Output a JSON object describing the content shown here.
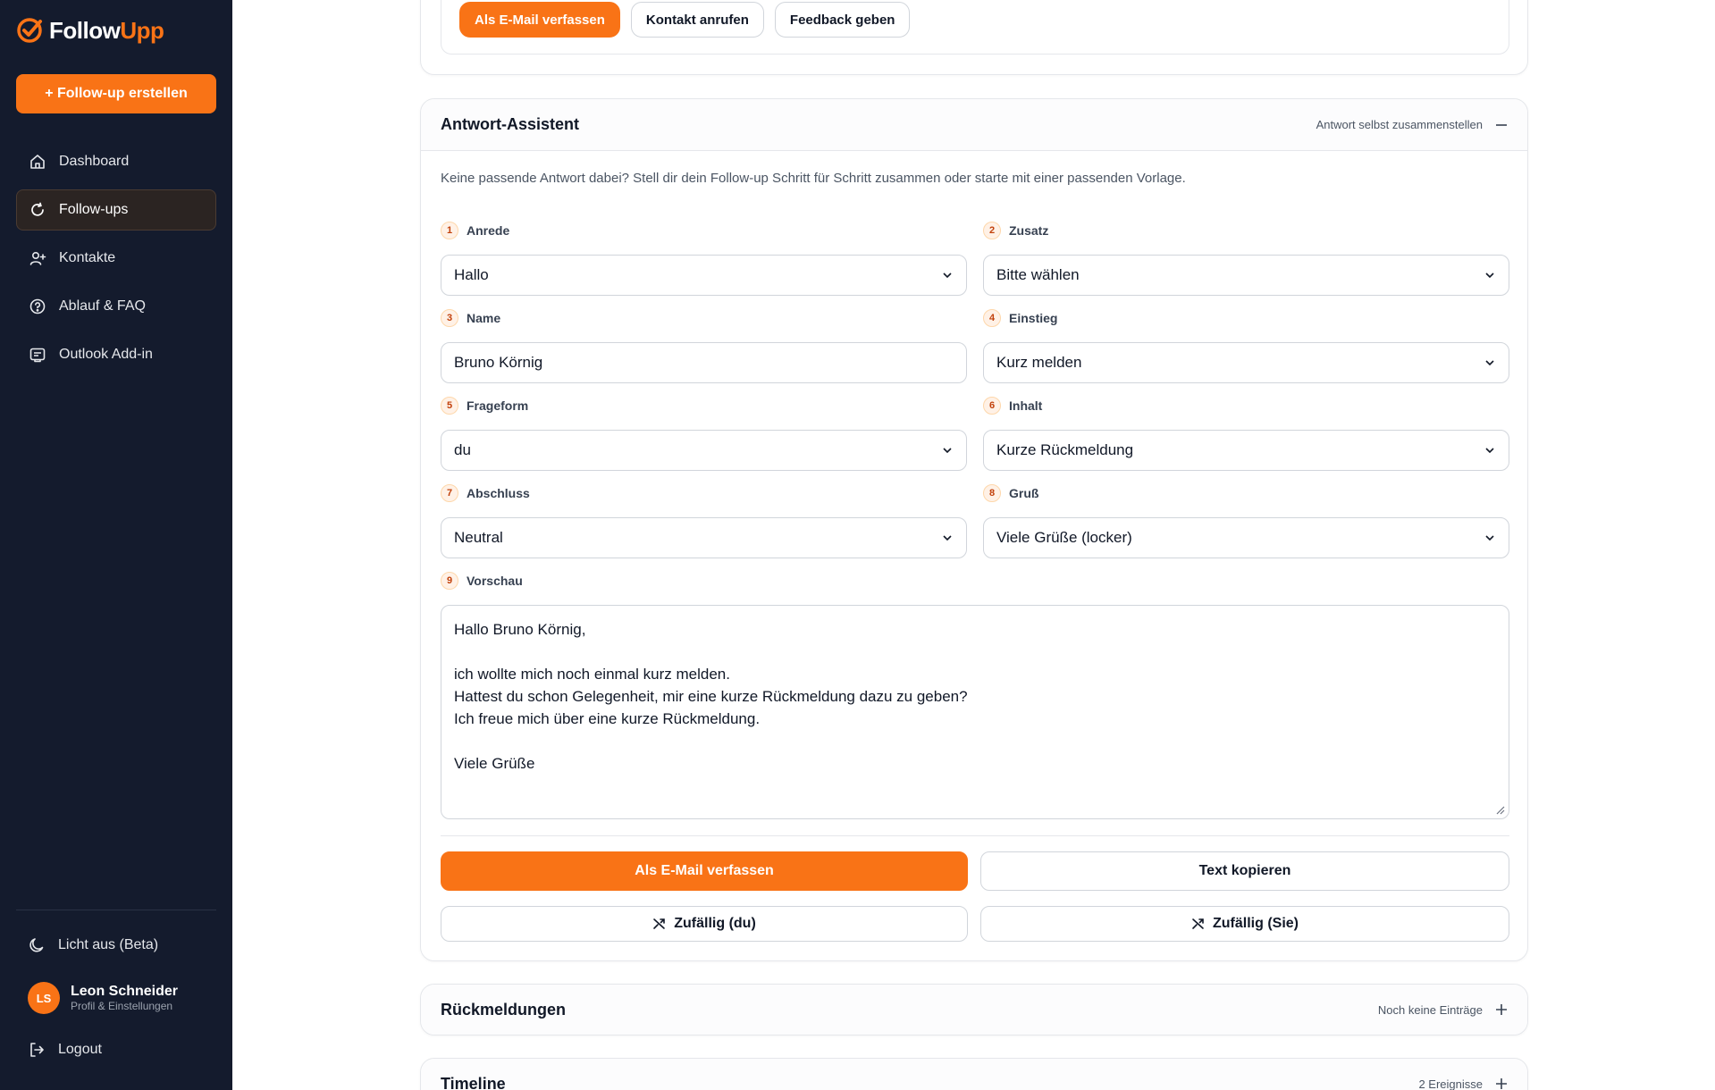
{
  "brand": {
    "name_a": "Follow",
    "name_b": "Upp",
    "accent": "#f97316",
    "sidebar_bg": "#141b2d"
  },
  "sidebar": {
    "create_label": "+ Follow-up erstellen",
    "items": [
      {
        "label": "Dashboard",
        "icon": "home-icon"
      },
      {
        "label": "Follow-ups",
        "icon": "refresh-icon",
        "active": true
      },
      {
        "label": "Kontakte",
        "icon": "user-plus-icon"
      },
      {
        "label": "Ablauf & FAQ",
        "icon": "help-circle-icon"
      },
      {
        "label": "Outlook Add-in",
        "icon": "mail-box-icon"
      }
    ],
    "theme_toggle": "Licht aus (Beta)",
    "user": {
      "initials": "LS",
      "name": "Leon Schneider",
      "sub": "Profil & Einstellungen"
    },
    "logout": "Logout"
  },
  "top_actions": {
    "email": "Als E-Mail verfassen",
    "call": "Kontakt anrufen",
    "feedback": "Feedback geben"
  },
  "assistant": {
    "title": "Antwort-Assistent",
    "head_action": "Antwort selbst zusammenstellen",
    "intro": "Keine passende Antwort dabei? Stell dir dein Follow-up Schritt für Schritt zusammen oder starte mit einer passenden Vorlage.",
    "fields": [
      {
        "num": "1",
        "label": "Anrede",
        "value": "Hallo",
        "type": "select"
      },
      {
        "num": "2",
        "label": "Zusatz",
        "value": "Bitte wählen",
        "type": "select"
      },
      {
        "num": "3",
        "label": "Name",
        "value": "Bruno Körnig",
        "type": "input"
      },
      {
        "num": "4",
        "label": "Einstieg",
        "value": "Kurz melden",
        "type": "select"
      },
      {
        "num": "5",
        "label": "Frageform",
        "value": "du",
        "type": "select"
      },
      {
        "num": "6",
        "label": "Inhalt",
        "value": "Kurze Rückmeldung",
        "type": "select"
      },
      {
        "num": "7",
        "label": "Abschluss",
        "value": "Neutral",
        "type": "select"
      },
      {
        "num": "8",
        "label": "Gruß",
        "value": "Viele Grüße (locker)",
        "type": "select"
      }
    ],
    "preview": {
      "num": "9",
      "label": "Vorschau",
      "lines": [
        "Hallo Bruno Körnig,",
        "",
        "ich wollte mich noch einmal kurz melden.",
        "Hattest du schon Gelegenheit, mir eine kurze Rückmeldung dazu zu geben?",
        "Ich freue mich über eine kurze Rückmeldung.",
        "",
        "Viele Grüße"
      ]
    },
    "actions": {
      "email": "Als E-Mail verfassen",
      "copy": "Text kopieren",
      "random_du": "Zufällig (du)",
      "random_sie": "Zufällig (Sie)"
    }
  },
  "feedback_section": {
    "title": "Rückmeldungen",
    "meta": "Noch keine Einträge"
  },
  "timeline_section": {
    "title": "Timeline",
    "meta": "2 Ereignisse"
  }
}
